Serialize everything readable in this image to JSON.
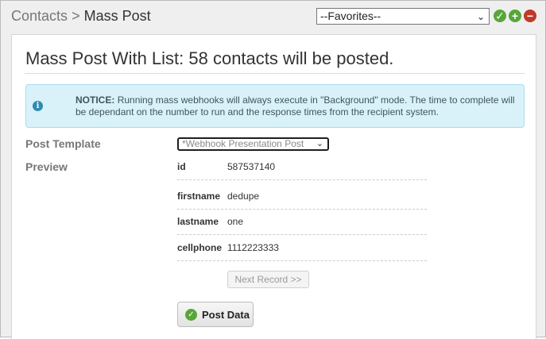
{
  "header": {
    "breadcrumb_parent": "Contacts",
    "breadcrumb_separator": ">",
    "breadcrumb_current": "Mass Post",
    "favorites_selected": "--Favorites--"
  },
  "main": {
    "title": "Mass Post With List: 58 contacts will be posted.",
    "notice": {
      "strong": "NOTICE:",
      "text": "Running mass webhooks will always execute in \"Background\" mode. The time to complete will be dependant on the number to run and the response times from the recipient system."
    },
    "form": {
      "post_template_label": "Post Template",
      "post_template_value": "*Webhook Presentation Post",
      "preview_label": "Preview"
    },
    "preview_fields": [
      {
        "name": "id",
        "value": "587537140"
      },
      {
        "name": "firstname",
        "value": "dedupe"
      },
      {
        "name": "lastname",
        "value": "one"
      },
      {
        "name": "cellphone",
        "value": "1112223333"
      }
    ],
    "next_record_label": "Next Record >>",
    "post_data_label": "Post Data"
  },
  "colors": {
    "accent_green": "#58a63a",
    "remove_red": "#c0392b",
    "notice_bg": "#d9f2fa"
  },
  "icons": [
    "check-circle-icon",
    "plus-circle-icon",
    "minus-circle-icon",
    "info-circle-icon",
    "chevron-down-icon"
  ]
}
